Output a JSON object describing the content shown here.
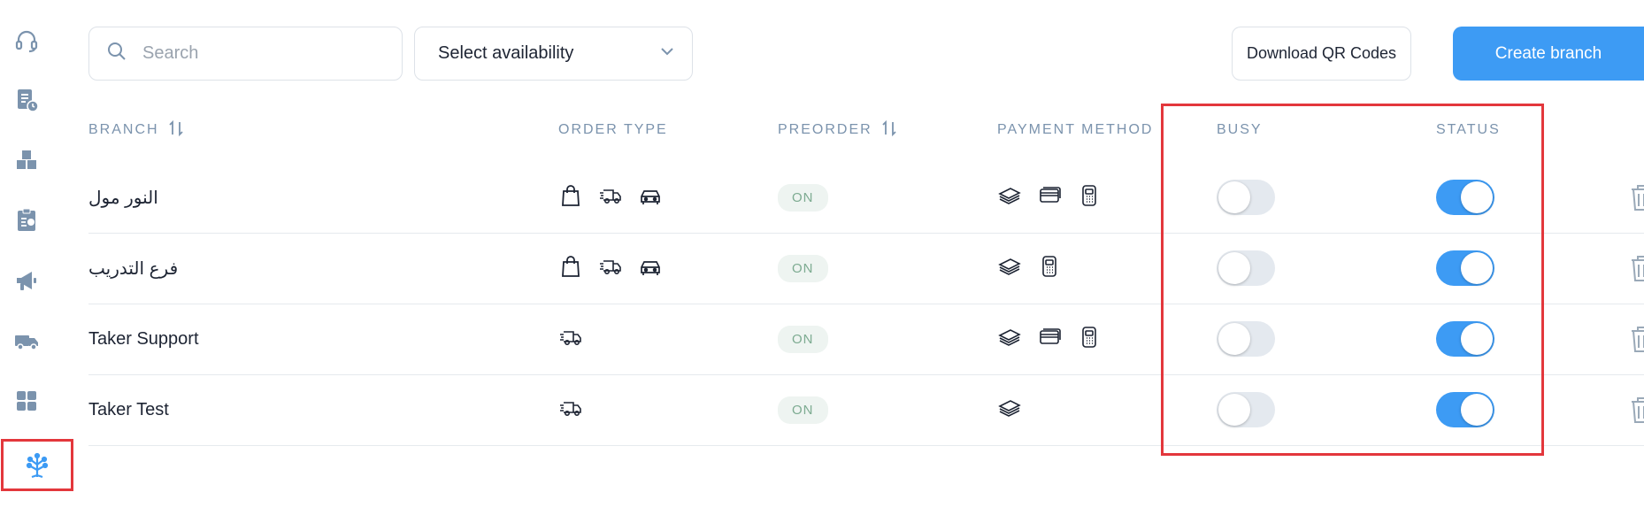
{
  "sidebar": {
    "items": [
      {
        "icon": "headset-icon"
      },
      {
        "icon": "orders-history-icon"
      },
      {
        "icon": "boxes-icon"
      },
      {
        "icon": "report-clipboard-icon"
      },
      {
        "icon": "megaphone-icon"
      },
      {
        "icon": "delivery-truck-icon"
      },
      {
        "icon": "grid-icon"
      },
      {
        "icon": "branch-tree-icon",
        "active": true
      }
    ]
  },
  "toolbar": {
    "search_placeholder": "Search",
    "availability_label": "Select availability",
    "download_label": "Download QR Codes",
    "create_label": "Create branch"
  },
  "table": {
    "headers": {
      "branch": "BRANCH",
      "order_type": "ORDER TYPE",
      "preorder": "PREORDER",
      "payment_method": "PAYMENT METHOD",
      "busy": "BUSY",
      "status": "STATUS"
    },
    "rows": [
      {
        "name": "النور مول",
        "order_types": [
          "bag-icon",
          "fast-delivery-icon",
          "car-icon"
        ],
        "preorder": "ON",
        "payments": [
          "cash-icon",
          "card-icon",
          "pos-terminal-icon"
        ],
        "busy": false,
        "status": true
      },
      {
        "name": "فرع التدريب",
        "order_types": [
          "bag-icon",
          "fast-delivery-icon",
          "car-icon"
        ],
        "preorder": "ON",
        "payments": [
          "cash-icon",
          "pos-terminal-icon"
        ],
        "busy": false,
        "status": true
      },
      {
        "name": "Taker Support",
        "order_types": [
          "fast-delivery-icon"
        ],
        "preorder": "ON",
        "payments": [
          "cash-icon",
          "card-icon",
          "pos-terminal-icon"
        ],
        "busy": false,
        "status": true
      },
      {
        "name": "Taker Test",
        "order_types": [
          "fast-delivery-icon"
        ],
        "preorder": "ON",
        "payments": [
          "cash-icon"
        ],
        "busy": false,
        "status": true
      }
    ]
  },
  "colors": {
    "accent": "#3d9bf4",
    "highlight": "#e3373c",
    "icon_gray": "#7b93ad",
    "badge_text": "#7dab91"
  }
}
